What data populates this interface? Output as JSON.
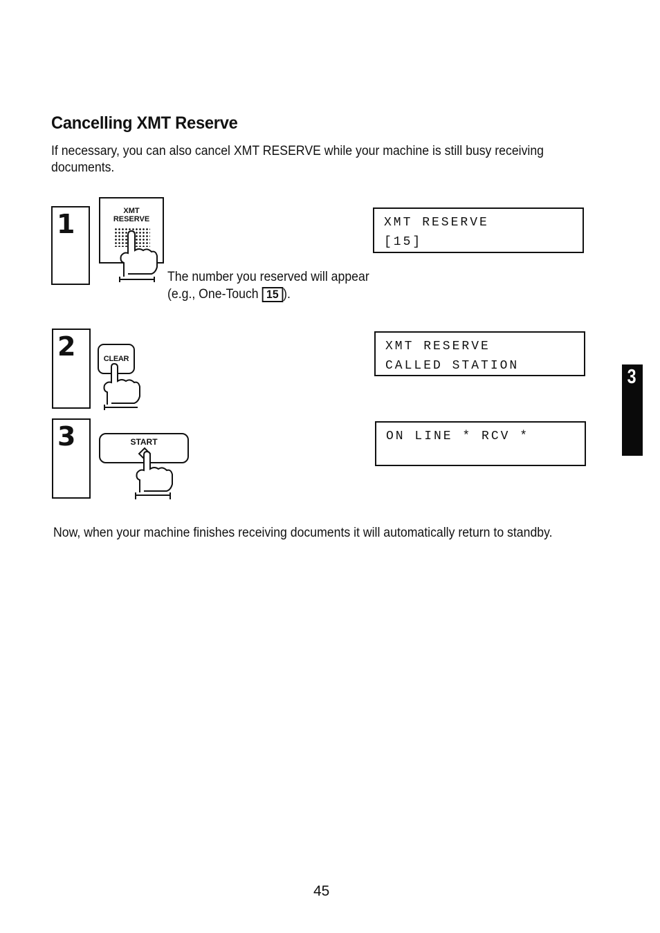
{
  "section": {
    "title": "Cancelling XMT Reserve",
    "intro": "If necessary, you can also cancel XMT RESERVE while your machine is still busy receiving documents."
  },
  "steps": [
    {
      "number": "1",
      "key": {
        "name": "xmt-reserve-key",
        "label_line1": "XMT",
        "label_line2": "RESERVE"
      },
      "display": {
        "line1": "XMT  RESERVE",
        "line2": "[15]"
      },
      "note_line1": "The number you reserved will appear",
      "note_line2_prefix": "(e.g., One-Touch",
      "note_key": "15",
      "note_line2_suffix": ")."
    },
    {
      "number": "2",
      "key": {
        "name": "clear-key",
        "label": "CLEAR"
      },
      "display": {
        "line1": "XMT  RESERVE",
        "line2": "CALLED  STATION"
      }
    },
    {
      "number": "3",
      "key": {
        "name": "start-key",
        "label": "START"
      },
      "display": {
        "line1": "ON  LINE  *  RCV  *",
        "line2": ""
      }
    }
  ],
  "outro": "Now, when your machine finishes receiving documents it will automatically return to standby.",
  "chapter_tab": "3",
  "page_number": "45"
}
